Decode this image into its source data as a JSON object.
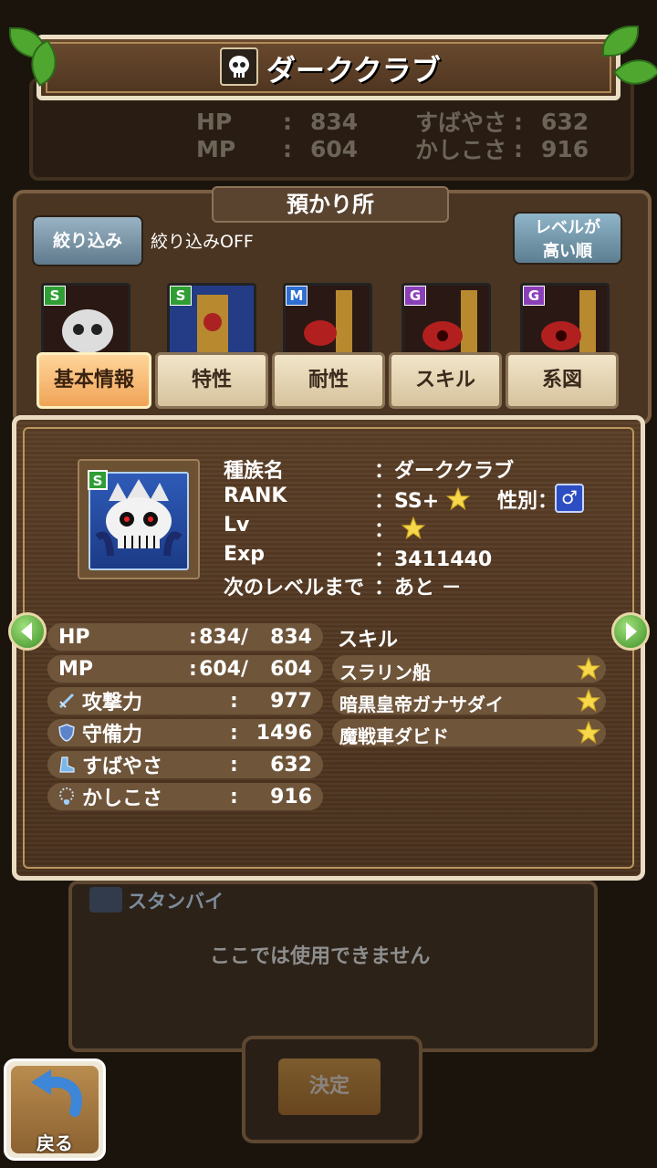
{
  "header": {
    "title": "ダーククラブ"
  },
  "background_status": {
    "rows": [
      {
        "l_label": "HP",
        "l_value": "834",
        "r_label": "すばやさ",
        "r_value": "632"
      },
      {
        "l_label": "MP",
        "l_value": "604",
        "r_label": "かしこさ",
        "r_value": "916"
      }
    ]
  },
  "storage": {
    "title": "預かり所",
    "filter_button": "絞り込み",
    "filter_status": "絞り込みOFF",
    "sort_button_line1": "レベルが",
    "sort_button_line2": "高い順",
    "cards": [
      {
        "rank": "S",
        "color": "#2f9e35"
      },
      {
        "rank": "S",
        "color": "#2f9e35"
      },
      {
        "rank": "M",
        "color": "#2f6fd1"
      },
      {
        "rank": "G",
        "color": "#8a3fb8"
      },
      {
        "rank": "G",
        "color": "#8a3fb8"
      }
    ]
  },
  "tabs": [
    "基本情報",
    "特性",
    "耐性",
    "スキル",
    "系図"
  ],
  "monster": {
    "rank_badge": "S",
    "labels": {
      "species": "種族名",
      "rank": "RANK",
      "lv": "Lv",
      "exp": "Exp",
      "next": "次のレベルまで"
    },
    "values": {
      "species": "：ダーククラブ",
      "rank": "：SS+",
      "lv": "：",
      "exp": "：3411440",
      "next": "：あと －"
    },
    "gender_label": "性別：",
    "gender_symbol": "♂"
  },
  "stats": [
    {
      "label": "HP",
      "colon": ":",
      "cur": "834",
      "slash": "/",
      "max": "834"
    },
    {
      "label": "MP",
      "colon": ":",
      "cur": "604",
      "slash": "/",
      "max": "604"
    },
    {
      "label": "攻撃力",
      "colon": ":",
      "max": "977"
    },
    {
      "label": "守備力",
      "colon": ":",
      "max": "1496"
    },
    {
      "label": "すばやさ",
      "colon": ":",
      "max": "632"
    },
    {
      "label": "かしこさ",
      "colon": ":",
      "max": "916"
    }
  ],
  "skills": {
    "header": "スキル",
    "items": [
      "スラリン船",
      "暗黒皇帝ガナサダイ",
      "魔戦車ダビド"
    ]
  },
  "lower": {
    "standby": "スタンバイ",
    "unusable": "ここでは使用できません",
    "confirm": "決定"
  },
  "back_button": "戻る",
  "colors": {
    "star": "#f7d84a",
    "accent_tab": "#f0a457"
  }
}
